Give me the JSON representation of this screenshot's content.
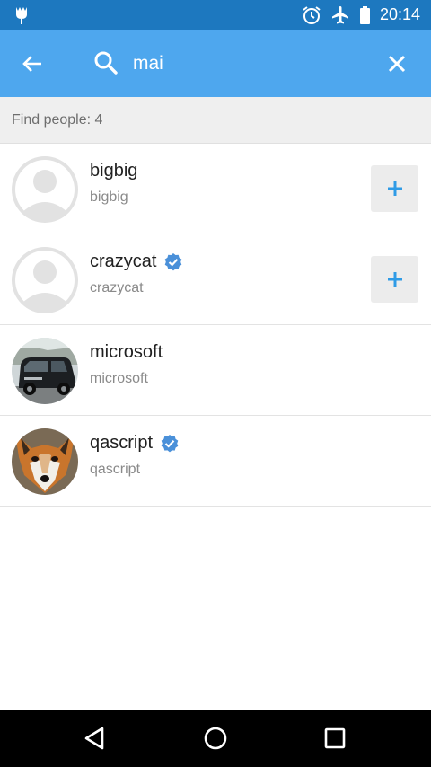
{
  "status_bar": {
    "time": "20:14",
    "icons": [
      "app-notification-icon",
      "alarm-icon",
      "airplane-mode-icon",
      "battery-icon"
    ]
  },
  "search": {
    "query": "mai",
    "back_icon": "arrow-left-icon",
    "search_icon": "search-icon",
    "clear_icon": "close-icon"
  },
  "results": {
    "count_label": "Find people: 4"
  },
  "people": [
    {
      "name": "bigbig",
      "username": "bigbig",
      "verified": false,
      "avatar": "default-avatar",
      "can_add": true
    },
    {
      "name": "crazycat",
      "username": "crazycat",
      "verified": true,
      "avatar": "default-avatar",
      "can_add": true
    },
    {
      "name": "microsoft",
      "username": "microsoft",
      "verified": false,
      "avatar": "photo-van",
      "can_add": false
    },
    {
      "name": "qascript",
      "username": "qascript",
      "verified": true,
      "avatar": "photo-fox",
      "can_add": false
    }
  ],
  "nav": [
    "back-icon",
    "home-icon",
    "recents-icon"
  ],
  "colors": {
    "status_bar": "#1d78bf",
    "toolbar": "#4ea7ee",
    "accent": "#2f9be6",
    "verified": "#4a90d9"
  }
}
